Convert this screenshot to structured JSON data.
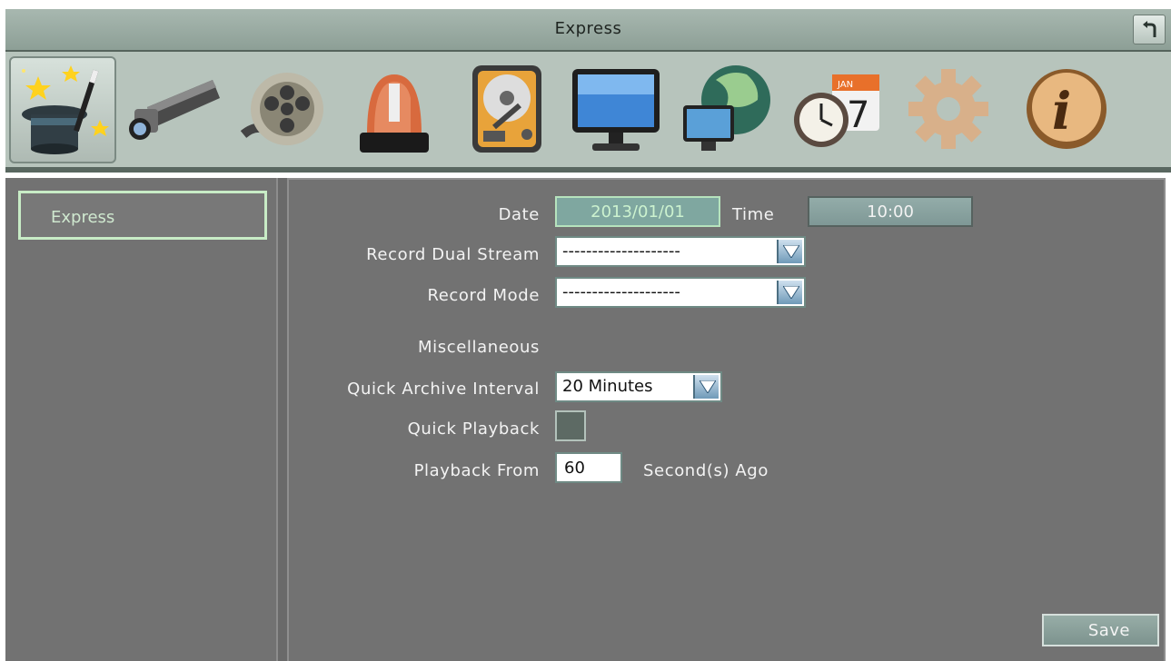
{
  "window": {
    "title": "Express"
  },
  "toolbar": {
    "items": [
      {
        "name": "express-wizard-icon",
        "active": true
      },
      {
        "name": "camera-icon",
        "active": false
      },
      {
        "name": "record-film-icon",
        "active": false
      },
      {
        "name": "alarm-icon",
        "active": false
      },
      {
        "name": "hard-disk-icon",
        "active": false
      },
      {
        "name": "display-monitor-icon",
        "active": false
      },
      {
        "name": "network-globe-icon",
        "active": false
      },
      {
        "name": "schedule-clock-calendar-icon",
        "active": false
      },
      {
        "name": "system-gear-icon",
        "active": false
      },
      {
        "name": "information-icon",
        "active": false
      }
    ],
    "calendar_month": "JAN",
    "calendar_day": "7",
    "info_letter": "i"
  },
  "sidebar": {
    "items": [
      {
        "label": "Express",
        "selected": true
      }
    ]
  },
  "form": {
    "date_label": "Date",
    "date_value": "2013/01/01",
    "time_label": "Time",
    "time_value": "10:00",
    "dual_stream_label": "Record Dual Stream",
    "dual_stream_value": "--------------------",
    "record_mode_label": "Record Mode",
    "record_mode_value": "--------------------",
    "misc_heading": "Miscellaneous",
    "quick_archive_label": "Quick Archive Interval",
    "quick_archive_value": "20 Minutes",
    "quick_playback_label": "Quick Playback",
    "quick_playback_checked": false,
    "playback_from_label": "Playback From",
    "playback_from_value": "60",
    "playback_from_unit": "Second(s) Ago"
  },
  "actions": {
    "save_label": "Save"
  },
  "colors": {
    "titlebar": "#9aab a2",
    "panel_bg": "#727272",
    "highlight_green": "#c8ecc6",
    "date_field": "#7fa7a0"
  }
}
